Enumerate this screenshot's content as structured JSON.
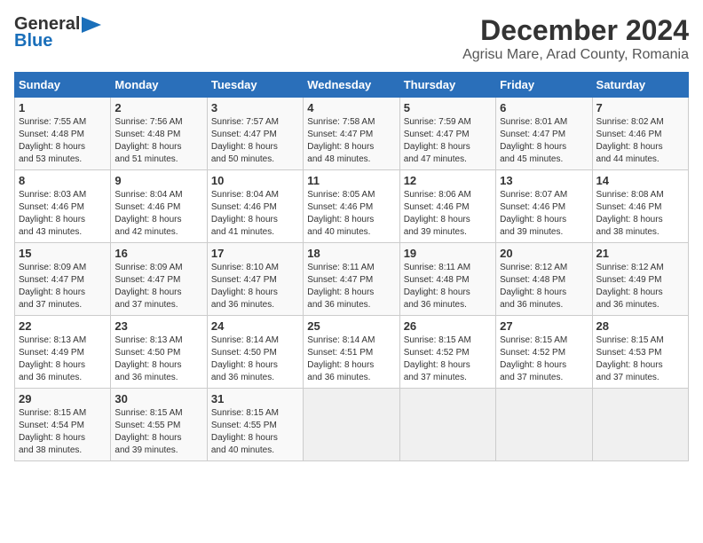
{
  "header": {
    "logo_line1": "General",
    "logo_line2": "Blue",
    "title": "December 2024",
    "subtitle": "Agrisu Mare, Arad County, Romania"
  },
  "calendar": {
    "days_of_week": [
      "Sunday",
      "Monday",
      "Tuesday",
      "Wednesday",
      "Thursday",
      "Friday",
      "Saturday"
    ],
    "weeks": [
      [
        {
          "day": "",
          "data": ""
        },
        {
          "day": "2",
          "data": "Sunrise: 7:56 AM\nSunset: 4:48 PM\nDaylight: 8 hours\nand 51 minutes."
        },
        {
          "day": "3",
          "data": "Sunrise: 7:57 AM\nSunset: 4:47 PM\nDaylight: 8 hours\nand 50 minutes."
        },
        {
          "day": "4",
          "data": "Sunrise: 7:58 AM\nSunset: 4:47 PM\nDaylight: 8 hours\nand 48 minutes."
        },
        {
          "day": "5",
          "data": "Sunrise: 7:59 AM\nSunset: 4:47 PM\nDaylight: 8 hours\nand 47 minutes."
        },
        {
          "day": "6",
          "data": "Sunrise: 8:01 AM\nSunset: 4:47 PM\nDaylight: 8 hours\nand 45 minutes."
        },
        {
          "day": "7",
          "data": "Sunrise: 8:02 AM\nSunset: 4:46 PM\nDaylight: 8 hours\nand 44 minutes."
        }
      ],
      [
        {
          "day": "1",
          "data": "Sunrise: 7:55 AM\nSunset: 4:48 PM\nDaylight: 8 hours\nand 53 minutes."
        },
        {
          "day": "",
          "data": ""
        },
        {
          "day": "",
          "data": ""
        },
        {
          "day": "",
          "data": ""
        },
        {
          "day": "",
          "data": ""
        },
        {
          "day": "",
          "data": ""
        },
        {
          "day": "",
          "data": ""
        }
      ],
      [
        {
          "day": "8",
          "data": "Sunrise: 8:03 AM\nSunset: 4:46 PM\nDaylight: 8 hours\nand 43 minutes."
        },
        {
          "day": "9",
          "data": "Sunrise: 8:04 AM\nSunset: 4:46 PM\nDaylight: 8 hours\nand 42 minutes."
        },
        {
          "day": "10",
          "data": "Sunrise: 8:04 AM\nSunset: 4:46 PM\nDaylight: 8 hours\nand 41 minutes."
        },
        {
          "day": "11",
          "data": "Sunrise: 8:05 AM\nSunset: 4:46 PM\nDaylight: 8 hours\nand 40 minutes."
        },
        {
          "day": "12",
          "data": "Sunrise: 8:06 AM\nSunset: 4:46 PM\nDaylight: 8 hours\nand 39 minutes."
        },
        {
          "day": "13",
          "data": "Sunrise: 8:07 AM\nSunset: 4:46 PM\nDaylight: 8 hours\nand 39 minutes."
        },
        {
          "day": "14",
          "data": "Sunrise: 8:08 AM\nSunset: 4:46 PM\nDaylight: 8 hours\nand 38 minutes."
        }
      ],
      [
        {
          "day": "15",
          "data": "Sunrise: 8:09 AM\nSunset: 4:47 PM\nDaylight: 8 hours\nand 37 minutes."
        },
        {
          "day": "16",
          "data": "Sunrise: 8:09 AM\nSunset: 4:47 PM\nDaylight: 8 hours\nand 37 minutes."
        },
        {
          "day": "17",
          "data": "Sunrise: 8:10 AM\nSunset: 4:47 PM\nDaylight: 8 hours\nand 36 minutes."
        },
        {
          "day": "18",
          "data": "Sunrise: 8:11 AM\nSunset: 4:47 PM\nDaylight: 8 hours\nand 36 minutes."
        },
        {
          "day": "19",
          "data": "Sunrise: 8:11 AM\nSunset: 4:48 PM\nDaylight: 8 hours\nand 36 minutes."
        },
        {
          "day": "20",
          "data": "Sunrise: 8:12 AM\nSunset: 4:48 PM\nDaylight: 8 hours\nand 36 minutes."
        },
        {
          "day": "21",
          "data": "Sunrise: 8:12 AM\nSunset: 4:49 PM\nDaylight: 8 hours\nand 36 minutes."
        }
      ],
      [
        {
          "day": "22",
          "data": "Sunrise: 8:13 AM\nSunset: 4:49 PM\nDaylight: 8 hours\nand 36 minutes."
        },
        {
          "day": "23",
          "data": "Sunrise: 8:13 AM\nSunset: 4:50 PM\nDaylight: 8 hours\nand 36 minutes."
        },
        {
          "day": "24",
          "data": "Sunrise: 8:14 AM\nSunset: 4:50 PM\nDaylight: 8 hours\nand 36 minutes."
        },
        {
          "day": "25",
          "data": "Sunrise: 8:14 AM\nSunset: 4:51 PM\nDaylight: 8 hours\nand 36 minutes."
        },
        {
          "day": "26",
          "data": "Sunrise: 8:15 AM\nSunset: 4:52 PM\nDaylight: 8 hours\nand 37 minutes."
        },
        {
          "day": "27",
          "data": "Sunrise: 8:15 AM\nSunset: 4:52 PM\nDaylight: 8 hours\nand 37 minutes."
        },
        {
          "day": "28",
          "data": "Sunrise: 8:15 AM\nSunset: 4:53 PM\nDaylight: 8 hours\nand 37 minutes."
        }
      ],
      [
        {
          "day": "29",
          "data": "Sunrise: 8:15 AM\nSunset: 4:54 PM\nDaylight: 8 hours\nand 38 minutes."
        },
        {
          "day": "30",
          "data": "Sunrise: 8:15 AM\nSunset: 4:55 PM\nDaylight: 8 hours\nand 39 minutes."
        },
        {
          "day": "31",
          "data": "Sunrise: 8:15 AM\nSunset: 4:55 PM\nDaylight: 8 hours\nand 40 minutes."
        },
        {
          "day": "",
          "data": ""
        },
        {
          "day": "",
          "data": ""
        },
        {
          "day": "",
          "data": ""
        },
        {
          "day": "",
          "data": ""
        }
      ]
    ]
  }
}
